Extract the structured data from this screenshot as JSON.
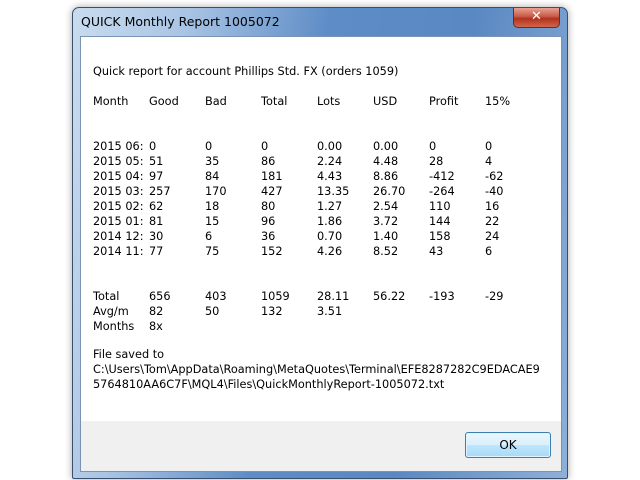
{
  "window": {
    "title": "QUICK Monthly Report 1005072",
    "close_label": "✕"
  },
  "report": {
    "heading": "Quick report for account Phillips Std. FX (orders 1059)",
    "columns": [
      "Month",
      "Good",
      "Bad",
      "Total",
      "Lots",
      "USD",
      "Profit",
      "15%"
    ],
    "rows": [
      [
        "2015 06:",
        "0",
        "0",
        "0",
        "0.00",
        "0.00",
        "0",
        "0"
      ],
      [
        "2015 05:",
        "51",
        "35",
        "86",
        "2.24",
        "4.48",
        "28",
        "4"
      ],
      [
        "2015 04:",
        "97",
        "84",
        "181",
        "4.43",
        "8.86",
        "-412",
        "-62"
      ],
      [
        "2015 03:",
        "257",
        "170",
        "427",
        "13.35",
        "26.70",
        "-264",
        "-40"
      ],
      [
        "2015 02:",
        "62",
        "18",
        "80",
        "1.27",
        "2.54",
        "110",
        "16"
      ],
      [
        "2015 01:",
        "81",
        "15",
        "96",
        "1.86",
        "3.72",
        "144",
        "22"
      ],
      [
        "2014 12:",
        "30",
        "6",
        "36",
        "0.70",
        "1.40",
        "158",
        "24"
      ],
      [
        "2014 11:",
        "77",
        "75",
        "152",
        "4.26",
        "8.52",
        "43",
        "6"
      ]
    ],
    "summary": [
      [
        "Total",
        "656",
        "403",
        "1059",
        "28.11",
        "56.22",
        "-193",
        "-29"
      ],
      [
        "Avg/m",
        "82",
        "50",
        "132",
        "3.51",
        "",
        "",
        ""
      ],
      [
        "Months",
        "8x",
        "",
        "",
        "",
        "",
        "",
        ""
      ]
    ],
    "file_saved_label": "File saved to",
    "path_line1": "C:\\Users\\Tom\\AppData\\Roaming\\MetaQuotes\\Terminal\\EFE8287282C9EDACAE9",
    "path_line2": "5764810AA6C7F\\MQL4\\Files\\QuickMonthlyReport-1005072.txt"
  },
  "buttons": {
    "ok": "OK"
  }
}
